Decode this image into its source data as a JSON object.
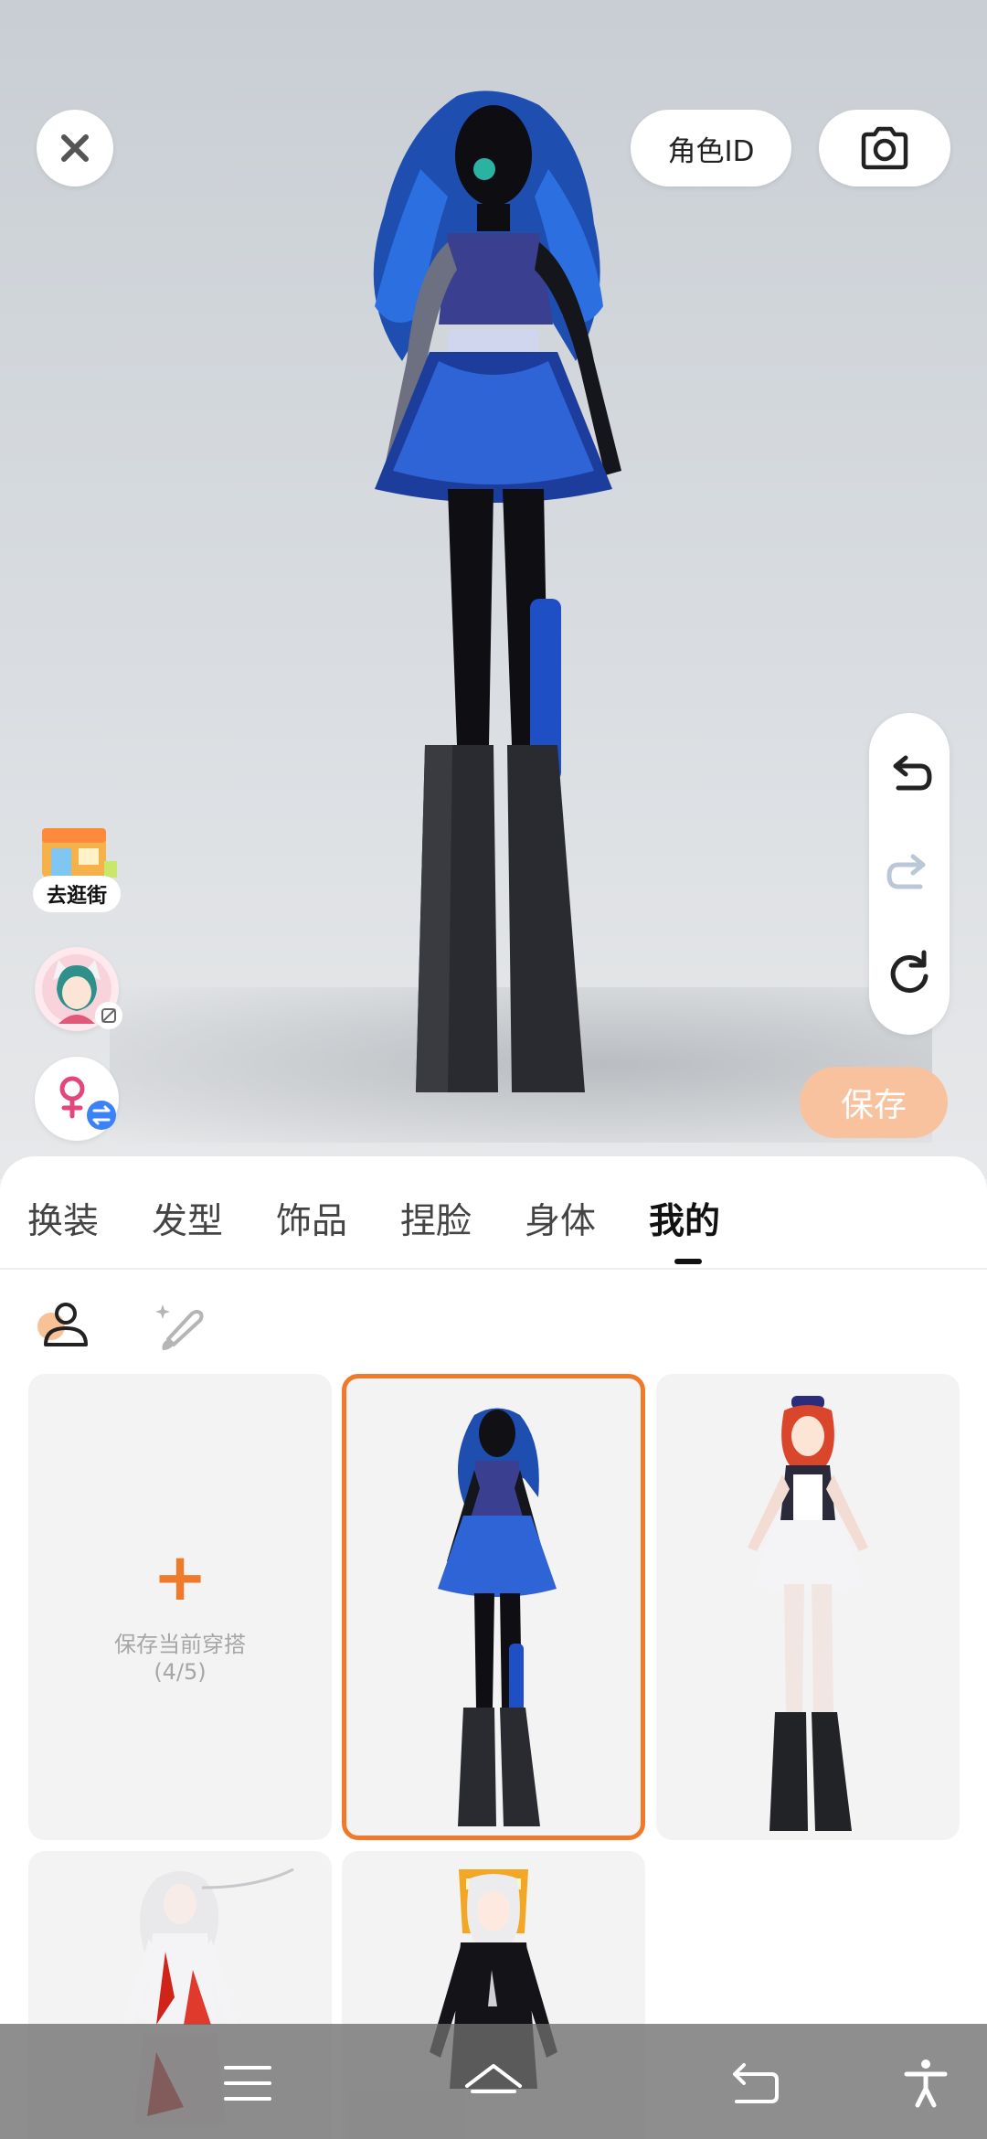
{
  "header": {
    "close_icon": "close-icon",
    "role_id_label": "角色ID",
    "camera_icon": "camera-icon"
  },
  "side_left": {
    "shop_label": "去逛街",
    "avatar_icon": "avatar-thumbnail",
    "gender_icon": "female-swap-icon"
  },
  "side_right": {
    "undo_icon": "undo-icon",
    "redo_icon": "redo-icon",
    "reset_icon": "reset-icon"
  },
  "save_label": "保存",
  "tabs": [
    {
      "label": "换装",
      "active": false
    },
    {
      "label": "发型",
      "active": false
    },
    {
      "label": "饰品",
      "active": false
    },
    {
      "label": "捏脸",
      "active": false
    },
    {
      "label": "身体",
      "active": false
    },
    {
      "label": "我的",
      "active": true
    }
  ],
  "subtabs": [
    {
      "icon": "person-icon",
      "active": true
    },
    {
      "icon": "magic-brush-icon",
      "active": false
    }
  ],
  "outfits": {
    "add_card": {
      "plus": "+",
      "label": "保存当前穿搭",
      "count": "(4/5)"
    },
    "items": [
      {
        "name": "blue-gothic-outfit",
        "selected": true
      },
      {
        "name": "maid-outfit",
        "selected": false
      },
      {
        "name": "white-hair-outfit",
        "selected": false
      },
      {
        "name": "black-hoodie-outfit",
        "selected": false
      }
    ]
  },
  "bottom_nav": {
    "menu_icon": "menu-icon",
    "home_icon": "home-icon",
    "back_icon": "back-icon",
    "accessibility_icon": "accessibility-icon"
  },
  "colors": {
    "accent": "#f07a2a",
    "save_button": "#f8c29e",
    "female_icon": "#e2467a",
    "swap_badge": "#3b82f6"
  }
}
